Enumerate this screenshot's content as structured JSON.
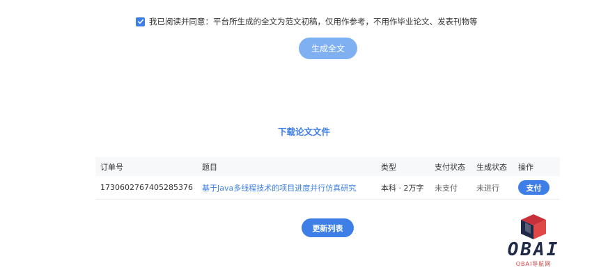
{
  "agreement": {
    "checked": true,
    "text": "我已阅读并同意：平台所生成的全文为范文初稿，仅用作参考，不用作毕业论文、发表刊物等"
  },
  "generate_button": "生成全文",
  "section_title": "下载论文文件",
  "table": {
    "headers": {
      "order": "订单号",
      "title": "题目",
      "type": "类型",
      "pay_status": "支付状态",
      "gen_status": "生成状态",
      "operation": "操作"
    },
    "rows": [
      {
        "order": "1730602767405285376",
        "title": "基于Java多线程技术的项目进度并行仿真研究",
        "type": "本科 · 2万字",
        "pay_status": "未支付",
        "gen_status": "未进行",
        "operation": "支付"
      }
    ]
  },
  "refresh_button": "更新列表",
  "watermark": {
    "logo_text": "OBAI",
    "sub_text": "OBAI导航网"
  },
  "colors": {
    "accent": "#3d7fe6",
    "accent_light": "#7fb0f2",
    "logo_red": "#c8313a",
    "logo_navy": "#1f2a48"
  }
}
